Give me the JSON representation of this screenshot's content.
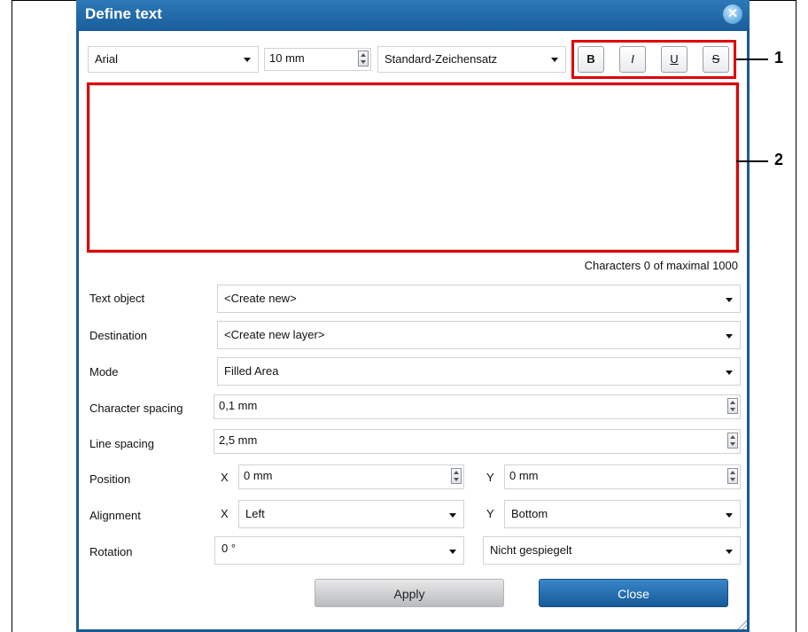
{
  "window": {
    "title": "Define text"
  },
  "toolbar": {
    "font": "Arial",
    "size": "10 mm",
    "charset": "Standard-Zeichensatz",
    "bold": "B",
    "italic": "I",
    "underline": "U",
    "strike": "S"
  },
  "editor": {
    "char_count": "Characters 0 of maximal 1000"
  },
  "form": {
    "text_object": {
      "label": "Text object",
      "value": "<Create new>"
    },
    "destination": {
      "label": "Destination",
      "value": "<Create new layer>"
    },
    "mode": {
      "label": "Mode",
      "value": "Filled Area"
    },
    "char_spacing": {
      "label": "Character spacing",
      "value": "0,1 mm"
    },
    "line_spacing": {
      "label": "Line spacing",
      "value": "2,5 mm"
    },
    "position": {
      "label": "Position",
      "x_label": "X",
      "x_value": "0 mm",
      "y_label": "Y",
      "y_value": "0 mm"
    },
    "alignment": {
      "label": "Alignment",
      "x_label": "X",
      "x_value": "Left",
      "y_label": "Y",
      "y_value": "Bottom"
    },
    "rotation": {
      "label": "Rotation",
      "value": "0 °",
      "mirror": "Nicht gespiegelt"
    }
  },
  "buttons": {
    "apply": "Apply",
    "close": "Close"
  },
  "callouts": {
    "one": "1",
    "two": "2"
  },
  "colors": {
    "title_bar": "#1f67a8",
    "highlight": "#e00000",
    "close_button": "#1d63a3"
  }
}
